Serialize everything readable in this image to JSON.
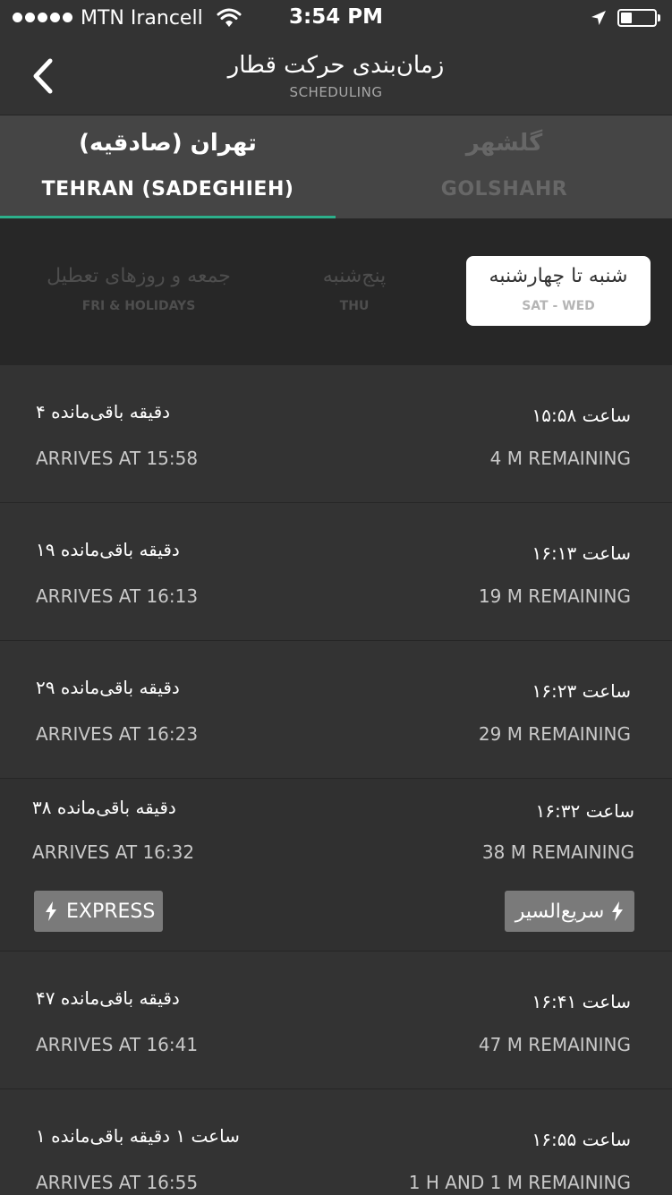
{
  "status_bar": {
    "carrier": "MTN Irancell",
    "time": "3:54 PM"
  },
  "nav": {
    "title": "زمان‌بندی حرکت قطار",
    "subtitle": "SCHEDULING"
  },
  "stations": [
    {
      "fa": "تهران (صادقیه)",
      "en": "TEHRAN (SADEGHIEH)",
      "active": true
    },
    {
      "fa": "گلشهر",
      "en": "GOLSHAHR",
      "active": false
    }
  ],
  "days": [
    {
      "fa": "جمعه و روزهای تعطیل",
      "en": "FRI & HOLIDAYS",
      "selected": false
    },
    {
      "fa": "پنج‌شنبه",
      "en": "THU",
      "selected": false
    },
    {
      "fa": "شنبه تا چهارشنبه",
      "en": "SAT - WED",
      "selected": true
    }
  ],
  "trips": [
    {
      "fa_remaining": "۴ دقیقه باقی‌مانده",
      "clock_fa": "ساعت ۱۵:۵۸",
      "arrives": "ARRIVES AT  15:58",
      "remaining_en": "4 M REMAINING"
    },
    {
      "fa_remaining": "۱۹ دقیقه باقی‌مانده",
      "clock_fa": "ساعت ۱۶:۱۳",
      "arrives": "ARRIVES AT  16:13",
      "remaining_en": "19 M REMAINING"
    },
    {
      "fa_remaining": "۲۹ دقیقه باقی‌مانده",
      "clock_fa": "ساعت ۱۶:۲۳",
      "arrives": "ARRIVES AT  16:23",
      "remaining_en": "29 M REMAINING"
    },
    {
      "fa_remaining": "۳۸ دقیقه باقی‌مانده",
      "clock_fa": "ساعت ۱۶:۳۲",
      "arrives": "ARRIVES AT  16:32",
      "remaining_en": "38 M REMAINING",
      "express": {
        "en": "EXPRESS",
        "fa": "سریع‌السیر"
      }
    },
    {
      "fa_remaining": "۴۷ دقیقه باقی‌مانده",
      "clock_fa": "ساعت ۱۶:۴۱",
      "arrives": "ARRIVES AT  16:41",
      "remaining_en": "47 M REMAINING"
    },
    {
      "fa_remaining": "۱ ساعت ۱ دقیقه باقی‌مانده",
      "clock_fa": "ساعت ۱۶:۵۵",
      "arrives": "ARRIVES AT  16:55",
      "remaining_en": "1 H AND 1  M REMAINING"
    }
  ],
  "colors": {
    "accent": "#2cb08b",
    "background": "#2f2f2f",
    "badge": "#7a7a7a"
  }
}
